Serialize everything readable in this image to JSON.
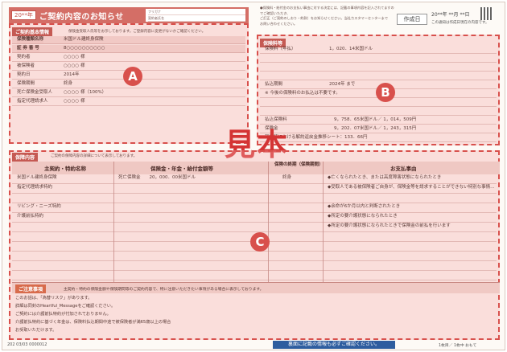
{
  "header": {
    "year": "20**年",
    "title": "ご契約内容のお知らせ",
    "mini_rows": [
      "フリガナ",
      "契約者氏名",
      "被保険者氏名"
    ]
  },
  "top_notes": {
    "lines": [
      "●保険料・給付金のお支払い事由に対する決定には、記載の事項内容を記入されてますのでご確認いただき、",
      "ご訂正（ご契約のしおり・約款）をお知らせください。当社カスタマーセンターまで",
      "お問い合わせください。"
    ],
    "sakusei": "作成日",
    "date": "20**年 **月 **日",
    "date_note": "この通知は作成日現在の内容です。"
  },
  "zoneA": {
    "section_label": "ご契約基本情報",
    "section_note": "保険金受取人氏等をお示しております。ご登録内容に変更がないかご確認ください。",
    "rows": [
      {
        "k": "保険種類名称",
        "v": "米国ドル建終身保険",
        "v2": "",
        "key": true
      },
      {
        "k": "証 券 番 号",
        "v": "8○○○○○○○○○○",
        "v2": "",
        "key": true
      },
      {
        "k": "契約者",
        "v": "○○○○ 様",
        "v2": ""
      },
      {
        "k": "被保険者",
        "v": "○○○○ 様",
        "v2": ""
      },
      {
        "k": "契約日",
        "v": "2014年",
        "v2": ""
      },
      {
        "k": "保険期間",
        "v": "終身",
        "v2": ""
      },
      {
        "k": "死亡保険金受取人",
        "v": "○○○○ 様（100%）",
        "v2": ""
      },
      {
        "k": "指定代理請求人",
        "v": "○○○○ 様",
        "v2": ""
      }
    ],
    "badge": "A"
  },
  "zoneB": {
    "section_label": "保険料等",
    "rows": [
      {
        "k": "保険料（年払）",
        "v": "1，020．14米国ドル"
      },
      {
        "k": "",
        "v": ""
      },
      {
        "k": "",
        "v": ""
      },
      {
        "k": "",
        "v": ""
      },
      {
        "k": "払込期間",
        "v": "2024年 まで"
      },
      {
        "k": "※ 今後の保険料のお払込は不要です。",
        "v": ""
      },
      {
        "k": "",
        "v": ""
      },
      {
        "k": "",
        "v": ""
      },
      {
        "k": "払込保険料",
        "v": "9，758．65米国ドル／ 1，014，509円"
      },
      {
        "k": "保険金",
        "v": "9，202．07米国ドル／ 1，243，315円"
      },
      {
        "k": "契約時における解約返戻金推移シート：133．66円",
        "v": ""
      }
    ],
    "badge": "B"
  },
  "watermark": "見本",
  "zoneC": {
    "section_label": "保障内容",
    "section_note": "ご契約の保障内容の詳細について表示しております。",
    "columns": [
      "主契約・特約名称",
      "保険金・年金・給付金額等",
      "保険の終期（保険期間）",
      "お支払事由"
    ],
    "rows": [
      {
        "name": "米国ドル建終身保険",
        "amount": "死亡保険金　　20，000．00米国ドル",
        "term": "終身",
        "reason": "◆亡くなられたとき、または高度障害状態になられたとき"
      },
      {
        "name": "指定代理請求特約",
        "amount": "",
        "term": "",
        "reason": "◆受取人である被保険者ご自身が、保険金等を請求することができない特別な事情があるときに、指定代理請求人が代わって請求することができます"
      },
      {
        "name": "",
        "amount": "",
        "term": "",
        "reason": ""
      },
      {
        "name": "リビング・ニーズ特約",
        "amount": "",
        "term": "",
        "reason": "◆余命が6か月以内と判断されたとき"
      },
      {
        "name": "介護前払特約",
        "amount": "",
        "term": "",
        "reason": "◆所定の要介護状態になられたとき"
      },
      {
        "name": "",
        "amount": "",
        "term": "",
        "reason": "◆所定の要介護状態になられたときで保険金の前払を行います"
      }
    ],
    "badge": "C",
    "attention_label": "ご注意事項",
    "attention_note": "主契約・特約の保険金額や保険期間等のご契約内容で、特に注意いただきたい事項がある場合に表示しております。",
    "attention_lines": [
      "このお話は、「為替リスク」があります。",
      "詳細は同封のHeartful_Messageをご確認ください。",
      "ご契約には介護前払特約が付加されておりません。",
      "介護前払特約に基づく年金は、保険料払込期間中途で被保険者が満65歳以上の場合",
      "お受取いただけます。"
    ]
  },
  "footer": {
    "code": "202 03/03 0000012",
    "blue_note": "裏面に記載の情報も必ずご確認ください。",
    "pages": "1枚目／ 1枚中 おもて"
  }
}
